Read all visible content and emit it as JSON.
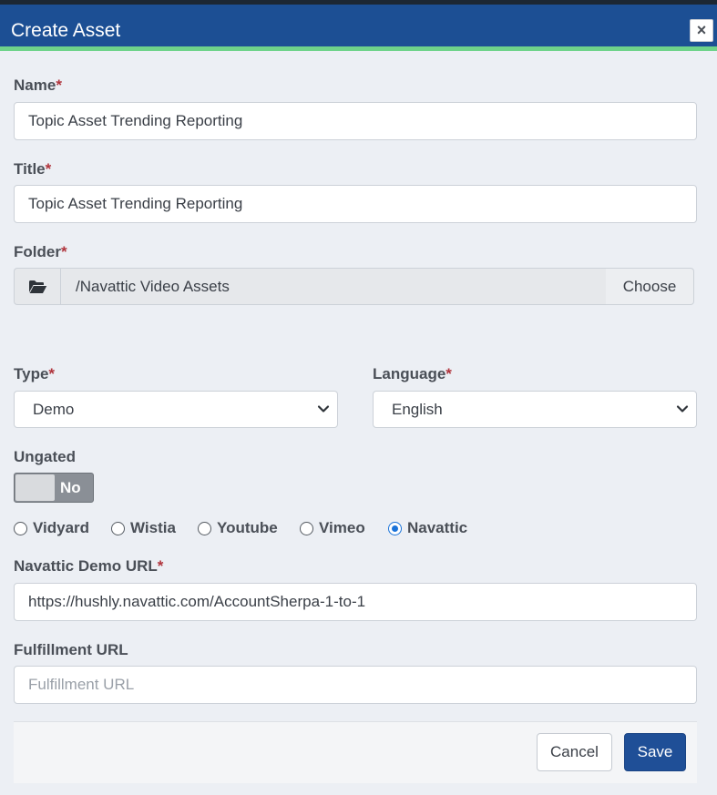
{
  "modal": {
    "title": "Create Asset",
    "close_label": "×"
  },
  "form": {
    "name": {
      "label": "Name",
      "required_mark": "*",
      "value": "Topic Asset Trending Reporting"
    },
    "title": {
      "label": "Title",
      "required_mark": "*",
      "value": "Topic Asset Trending Reporting"
    },
    "folder": {
      "label": "Folder",
      "required_mark": "*",
      "icon": "folder-open-icon",
      "path": "/Navattic Video Assets",
      "choose_label": "Choose"
    },
    "type": {
      "label": "Type",
      "required_mark": "*",
      "selected": "Demo"
    },
    "language": {
      "label": "Language",
      "required_mark": "*",
      "selected": "English"
    },
    "ungated": {
      "label": "Ungated",
      "state_text": "No",
      "on": false
    },
    "platforms": [
      {
        "label": "Vidyard",
        "checked": false
      },
      {
        "label": "Wistia",
        "checked": false
      },
      {
        "label": "Youtube",
        "checked": false
      },
      {
        "label": "Vimeo",
        "checked": false
      },
      {
        "label": "Navattic",
        "checked": true
      }
    ],
    "demo_url": {
      "label": "Navattic Demo URL",
      "required_mark": "*",
      "value": "https://hushly.navattic.com/AccountSherpa-1-to-1"
    },
    "fulfillment_url": {
      "label": "Fulfillment URL",
      "placeholder": "Fulfillment URL",
      "value": ""
    }
  },
  "footer": {
    "cancel_label": "Cancel",
    "save_label": "Save"
  },
  "colors": {
    "header": "#1c4f94",
    "accent": "#6ed38a",
    "primary_button": "#1f4f97",
    "required": "#b0343c",
    "radio_checked": "#1a73d9"
  }
}
